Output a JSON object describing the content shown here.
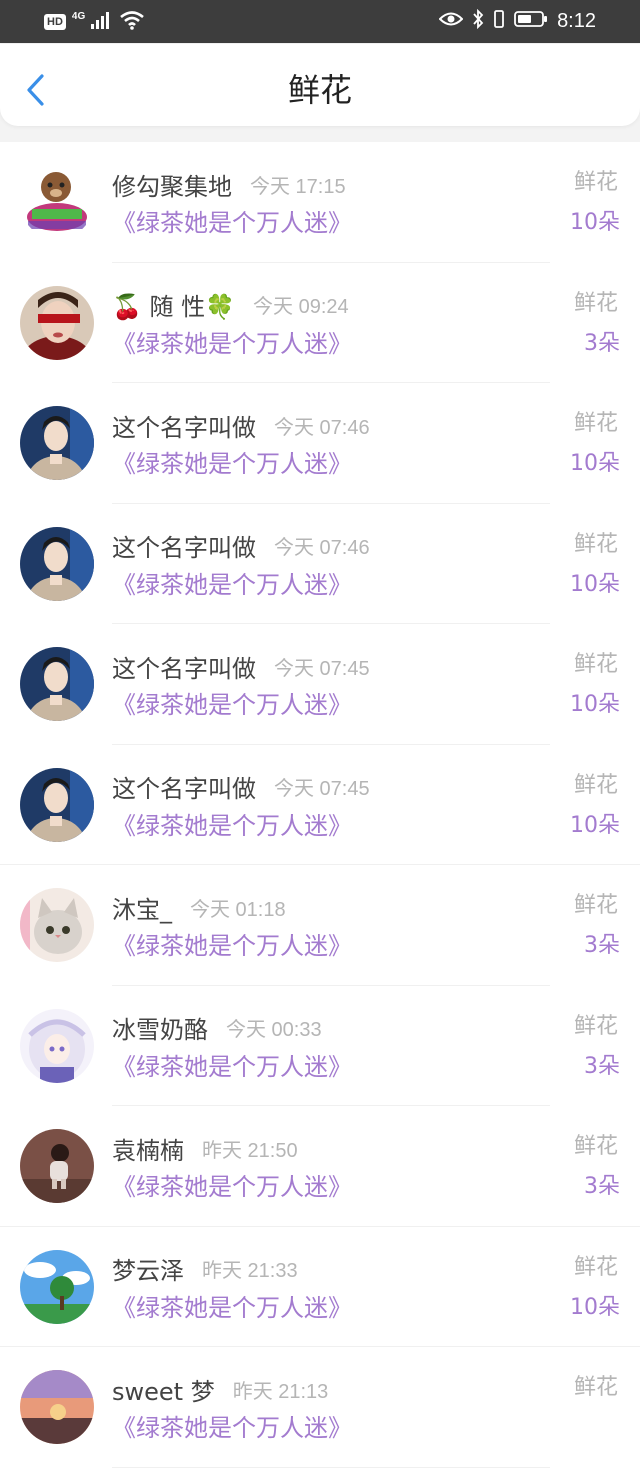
{
  "status_bar": {
    "hd": "HD",
    "network": "4G",
    "time": "8:12"
  },
  "header": {
    "title": "鲜花",
    "back_icon": "chevron-left-icon",
    "accent_color": "#3a8fe8"
  },
  "colors": {
    "book_title": "#a37bcf",
    "meta": "#b5b5b5"
  },
  "items": [
    {
      "name": "修勾聚集地",
      "time": "今天 17:15",
      "book": "《绿茶她是个万人迷》",
      "tag": "鲜花",
      "count": "10朵",
      "avatar": "cartoon-dog-avatar"
    },
    {
      "name": "🍒 随 性🍀",
      "time": "今天 09:24",
      "book": "《绿茶她是个万人迷》",
      "tag": "鲜花",
      "count": "3朵",
      "avatar": "blindfold-girl-avatar"
    },
    {
      "name": "这个名字叫做",
      "time": "今天 07:46",
      "book": "《绿茶她是个万人迷》",
      "tag": "鲜花",
      "count": "10朵",
      "avatar": "young-man-avatar"
    },
    {
      "name": "这个名字叫做",
      "time": "今天 07:46",
      "book": "《绿茶她是个万人迷》",
      "tag": "鲜花",
      "count": "10朵",
      "avatar": "young-man-avatar"
    },
    {
      "name": "这个名字叫做",
      "time": "今天 07:45",
      "book": "《绿茶她是个万人迷》",
      "tag": "鲜花",
      "count": "10朵",
      "avatar": "young-man-avatar"
    },
    {
      "name": "这个名字叫做",
      "time": "今天 07:45",
      "book": "《绿茶她是个万人迷》",
      "tag": "鲜花",
      "count": "10朵",
      "avatar": "young-man-avatar"
    },
    {
      "name": "沐宝_",
      "time": "今天 01:18",
      "book": "《绿茶她是个万人迷》",
      "tag": "鲜花",
      "count": "3朵",
      "avatar": "cat-avatar"
    },
    {
      "name": "冰雪奶酪",
      "time": "今天 00:33",
      "book": "《绿茶她是个万人迷》",
      "tag": "鲜花",
      "count": "3朵",
      "avatar": "anime-girl-avatar"
    },
    {
      "name": "袁楠楠",
      "time": "昨天 21:50",
      "book": "《绿茶她是个万人迷》",
      "tag": "鲜花",
      "count": "3朵",
      "avatar": "toddler-avatar"
    },
    {
      "name": "梦云泽",
      "time": "昨天 21:33",
      "book": "《绿茶她是个万人迷》",
      "tag": "鲜花",
      "count": "10朵",
      "avatar": "tree-sky-avatar"
    },
    {
      "name": "sweet 梦",
      "time": "昨天 21:13",
      "book": "《绿茶她是个万人迷》",
      "tag": "鲜花",
      "count": "",
      "avatar": "sunset-avatar"
    }
  ]
}
